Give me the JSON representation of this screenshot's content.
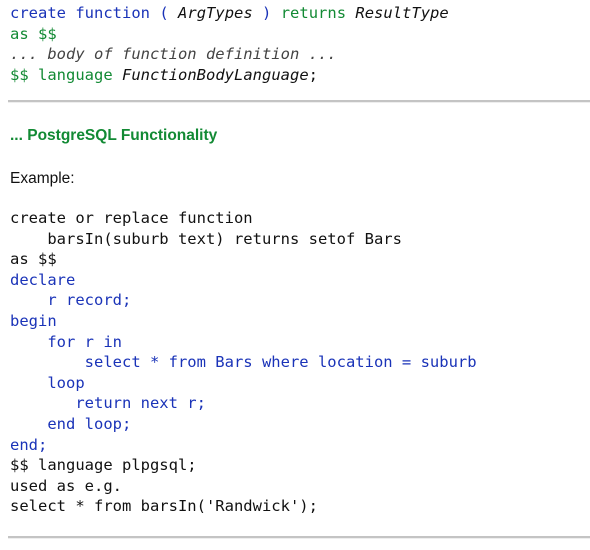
{
  "syntax_block": {
    "line1": {
      "kw_create": "create",
      "kw_function": "function",
      "open_paren": "(",
      "arg_types": "ArgTypes",
      "close_paren": ")",
      "kw_returns": "returns",
      "result_type": "ResultType"
    },
    "line2": {
      "kw_as": "as",
      "dollar": "$$"
    },
    "line3": {
      "comment": "... body of function definition ..."
    },
    "line4": {
      "dollar": "$$",
      "kw_language": "language",
      "function_body_language": "FunctionBodyLanguage",
      "semicolon": ";"
    }
  },
  "section_heading": "... PostgreSQL Functionality",
  "example_label": "Example:",
  "example_code": [
    {
      "indent": "",
      "color": "black",
      "text": "create or replace function"
    },
    {
      "indent": "    ",
      "color": "black",
      "text": "barsIn(suburb text) returns setof Bars"
    },
    {
      "indent": "",
      "color": "black",
      "text": "as $$"
    },
    {
      "indent": "",
      "color": "blue",
      "text": "declare"
    },
    {
      "indent": "    ",
      "color": "blue",
      "text": "r record;"
    },
    {
      "indent": "",
      "color": "blue",
      "text": "begin"
    },
    {
      "indent": "    ",
      "color": "blue",
      "text": "for r in"
    },
    {
      "indent": "        ",
      "color": "blue",
      "text": "select * from Bars where location = suburb"
    },
    {
      "indent": "    ",
      "color": "blue",
      "text": "loop"
    },
    {
      "indent": "       ",
      "color": "blue",
      "text": "return next r;"
    },
    {
      "indent": "    ",
      "color": "blue",
      "text": "end loop;"
    },
    {
      "indent": "",
      "color": "blue",
      "text": "end;"
    },
    {
      "indent": "",
      "color": "black",
      "text": "$$ language plpgsql;"
    },
    {
      "indent": "",
      "color": "black",
      "text": "used as e.g."
    },
    {
      "indent": "",
      "color": "black",
      "text": "select * from barsIn('Randwick');"
    }
  ]
}
